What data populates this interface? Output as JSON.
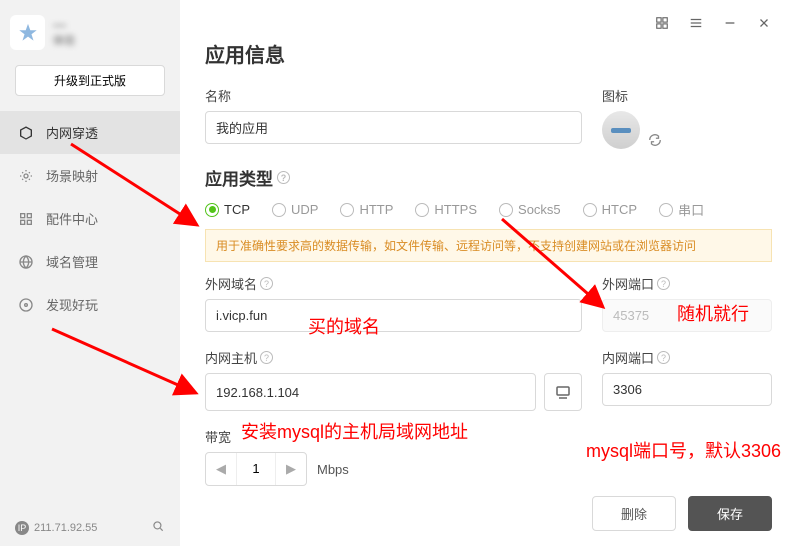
{
  "sidebar": {
    "profile_name": "—",
    "profile_sub": "体验",
    "upgrade": "升级到正式版",
    "nav": [
      {
        "label": "内网穿透"
      },
      {
        "label": "场景映射"
      },
      {
        "label": "配件中心"
      },
      {
        "label": "域名管理"
      },
      {
        "label": "发现好玩"
      }
    ],
    "ip": "211.71.92.55"
  },
  "header": {
    "title": "应用信息"
  },
  "fields": {
    "name_label": "名称",
    "name_value": "我的应用",
    "icon_label": "图标"
  },
  "apptype": {
    "title": "应用类型",
    "options": [
      "TCP",
      "UDP",
      "HTTP",
      "HTTPS",
      "Socks5",
      "HTCP",
      "串口"
    ],
    "tip": "用于准确性要求高的数据传输，如文件传输、远程访问等，不支持创建网站或在浏览器访问"
  },
  "ext": {
    "domain_label": "外网域名",
    "domain_value": "i.vicp.fun",
    "port_label": "外网端口",
    "port_value": "45375"
  },
  "intr": {
    "host_label": "内网主机",
    "host_value": "192.168.1.104",
    "port_label": "内网端口",
    "port_value": "3306"
  },
  "bandwidth": {
    "label": "带宽",
    "value": "1",
    "unit": "Mbps"
  },
  "footer": {
    "delete": "删除",
    "save": "保存"
  },
  "annotations": {
    "a1": "买的域名",
    "a2": "随机就行",
    "a3": "安装mysql的主机局域网地址",
    "a4": "mysql端口号，默认3306"
  }
}
